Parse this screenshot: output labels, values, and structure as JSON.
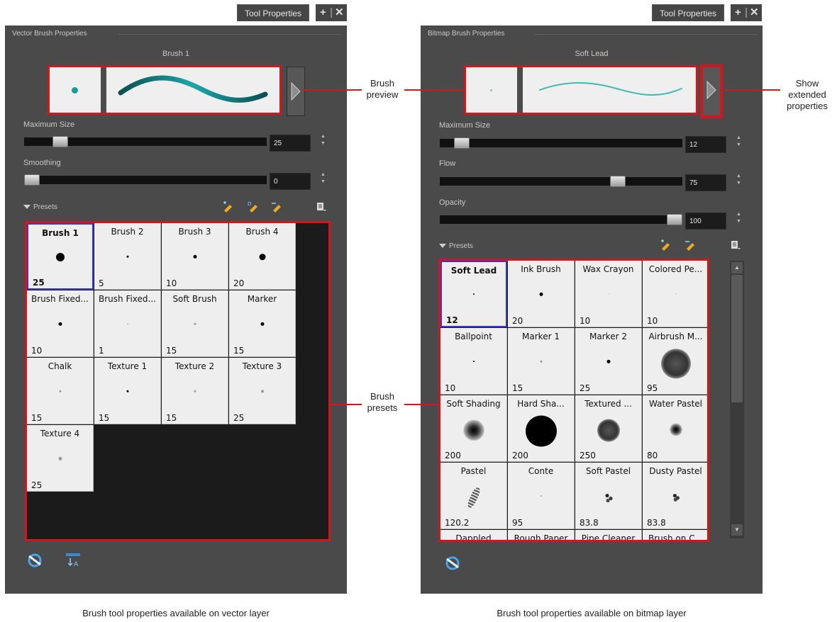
{
  "vector_panel": {
    "tab_label": "Tool Properties",
    "group_title": "Vector Brush Properties",
    "brush_name": "Brush 1",
    "sliders": [
      {
        "label": "Maximum Size",
        "value": "25",
        "level": 0.12
      },
      {
        "label": "Smoothing",
        "value": "0",
        "level": 0.0
      }
    ],
    "presets_label": "Presets",
    "presets": [
      {
        "name": "Brush 1",
        "size": "25",
        "dot": 12,
        "selected": true
      },
      {
        "name": "Brush 2",
        "size": "5",
        "dot": 3
      },
      {
        "name": "Brush 3",
        "size": "10",
        "dot": 5
      },
      {
        "name": "Brush 4",
        "size": "20",
        "dot": 9
      },
      {
        "name": "Brush Fixed...",
        "size": "10",
        "dot": 5
      },
      {
        "name": "Brush Fixed...",
        "size": "1",
        "dot": 1
      },
      {
        "name": "Soft Brush",
        "size": "15",
        "dot": 3,
        "soft": true
      },
      {
        "name": "Marker",
        "size": "15",
        "dot": 5
      },
      {
        "name": "Chalk",
        "size": "15",
        "dot": 3,
        "soft": true
      },
      {
        "name": "Texture 1",
        "size": "15",
        "dot": 3
      },
      {
        "name": "Texture 2",
        "size": "15",
        "dot": 3,
        "soft": true
      },
      {
        "name": "Texture 3",
        "size": "25",
        "dot": 4,
        "soft": true
      },
      {
        "name": "Texture 4",
        "size": "25",
        "dot": 5,
        "soft": true
      }
    ]
  },
  "bitmap_panel": {
    "tab_label": "Tool Properties",
    "group_title": "Bitmap Brush Properties",
    "brush_name": "Soft Lead",
    "sliders": [
      {
        "label": "Maximum Size",
        "value": "12",
        "level": 0.06
      },
      {
        "label": "Flow",
        "value": "75",
        "level": 0.75
      },
      {
        "label": "Opacity",
        "value": "100",
        "level": 1.0
      }
    ],
    "presets_label": "Presets",
    "presets": [
      {
        "name": "Soft Lead",
        "size": "12",
        "dot": 2,
        "selected": true
      },
      {
        "name": "Ink Brush",
        "size": "20",
        "dot": 5
      },
      {
        "name": "Wax Crayon",
        "size": "10",
        "dot": 1,
        "soft": true
      },
      {
        "name": "Colored Pe...",
        "size": "10",
        "dot": 1,
        "soft": true
      },
      {
        "name": "Ballpoint",
        "size": "10",
        "dot": 2
      },
      {
        "name": "Marker 1",
        "size": "15",
        "dot": 3,
        "soft": true
      },
      {
        "name": "Marker 2",
        "size": "25",
        "dot": 5
      },
      {
        "name": "Airbrush M...",
        "size": "95",
        "dot": 42,
        "texture": true
      },
      {
        "name": "Soft Shading",
        "size": "200",
        "dot": 30,
        "blur": true
      },
      {
        "name": "Hard Sha...",
        "size": "200",
        "dot": 44
      },
      {
        "name": "Textured ...",
        "size": "250",
        "dot": 32,
        "blur": true,
        "texture": true
      },
      {
        "name": "Water Pastel",
        "size": "80",
        "dot": 18,
        "blur": true
      },
      {
        "name": "Pastel",
        "size": "120.2",
        "dot": 10,
        "stroke": true
      },
      {
        "name": "Conte",
        "size": "95",
        "dot": 2,
        "soft": true
      },
      {
        "name": "Soft Pastel",
        "size": "83.8",
        "dot": 20,
        "speckle": true
      },
      {
        "name": "Dusty Pastel",
        "size": "83.8",
        "dot": 16,
        "speckle": true
      },
      {
        "name": "Dappled",
        "size": "",
        "dot": 0
      },
      {
        "name": "Rough Paper",
        "size": "",
        "dot": 0
      },
      {
        "name": "Pipe Cleaner",
        "size": "",
        "dot": 0
      },
      {
        "name": "Brush on C...",
        "size": "",
        "dot": 0
      }
    ]
  },
  "annotations": {
    "brush_preview": "Brush preview",
    "brush_preview_l1": "Brush",
    "brush_preview_l2": "preview",
    "brush_presets_l1": "Brush",
    "brush_presets_l2": "presets",
    "show_ext_l1": "Show",
    "show_ext_l2": "extended",
    "show_ext_l3": "properties"
  },
  "captions": {
    "vector": "Brush tool properties available on vector layer",
    "bitmap": "Brush tool properties available on bitmap layer"
  },
  "colors": {
    "highlight": "#d4151c",
    "selection": "#3737d5",
    "stroke": "#1a8a8a"
  }
}
